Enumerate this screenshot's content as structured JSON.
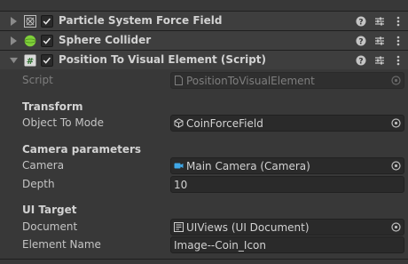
{
  "components": [
    {
      "title": "Particle System Force Field",
      "icon": "particle-system-force-field-icon",
      "expanded": false,
      "enabled": true
    },
    {
      "title": "Sphere Collider",
      "icon": "sphere-collider-icon",
      "expanded": false,
      "enabled": true
    },
    {
      "title": "Position To Visual Element (Script)",
      "icon": "script-icon",
      "expanded": true,
      "enabled": true
    }
  ],
  "script": {
    "label": "Script",
    "value": "PositionToVisualElement"
  },
  "transform_section": {
    "header": "Transform",
    "object_to_mode": {
      "label": "Object To Mode",
      "value": "CoinForceField"
    }
  },
  "camera_section": {
    "header": "Camera parameters",
    "camera": {
      "label": "Camera",
      "value": "Main Camera (Camera)"
    },
    "depth": {
      "label": "Depth",
      "value": "10"
    }
  },
  "ui_target_section": {
    "header": "UI Target",
    "document": {
      "label": "Document",
      "value": "UIViews (UI Document)"
    },
    "element_name": {
      "label": "Element Name",
      "value": "Image--Coin_Icon"
    }
  },
  "colors": {
    "background": "#383838",
    "header_bg": "#3e3e3e",
    "field_bg": "#2a2a2a",
    "sphere_green": "#7fd03a",
    "camera_blue": "#3fa7e6"
  }
}
